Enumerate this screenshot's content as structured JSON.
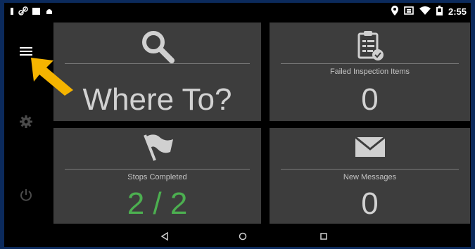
{
  "status_bar": {
    "time": "2:55",
    "left_icons": [
      "signal-icon",
      "link-icon",
      "square-icon",
      "android-icon"
    ],
    "right_icons": [
      "location-icon",
      "cast-icon",
      "wifi-icon",
      "battery-icon"
    ]
  },
  "rail": {
    "items": [
      {
        "name": "menu-icon"
      },
      {
        "name": "settings-icon"
      },
      {
        "name": "power-icon"
      }
    ]
  },
  "tiles": {
    "where_to": {
      "value": "Where To?",
      "icon": "search-icon"
    },
    "failed_inspection": {
      "label": "Failed Inspection Items",
      "value": "0",
      "icon": "clipboard-check-icon"
    },
    "stops_completed": {
      "label": "Stops Completed",
      "value": "2 / 2",
      "icon": "flag-icon",
      "value_color": "#4caf50"
    },
    "new_messages": {
      "label": "New Messages",
      "value": "0",
      "icon": "mail-icon"
    }
  },
  "navigation_bar": {
    "icons": [
      "back-icon",
      "home-icon",
      "recents-icon"
    ]
  },
  "colors": {
    "accent_arrow": "#f5b400",
    "tile_bg": "#3d3d3d",
    "success_green": "#4caf50"
  }
}
